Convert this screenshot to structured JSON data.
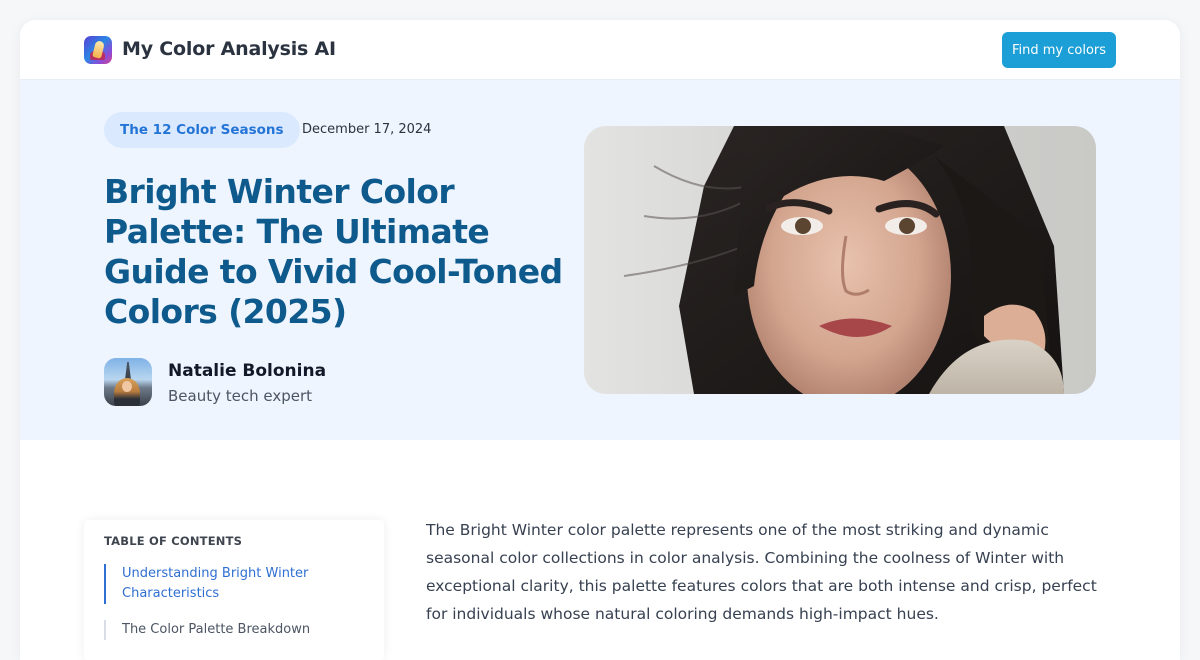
{
  "header": {
    "brand": "My Color Analysis AI",
    "cta_label": "Find my colors"
  },
  "hero": {
    "category": "The 12 Color Seasons",
    "date": "December 17, 2024",
    "title": "Bright Winter Color Palette: The Ultimate Guide to Vivid Cool-Toned Colors (2025)",
    "author": {
      "name": "Natalie Bolonina",
      "role": "Beauty tech expert"
    }
  },
  "toc": {
    "heading": "TABLE OF CONTENTS",
    "items": [
      {
        "label": "Understanding Bright Winter Characteristics",
        "active": true
      },
      {
        "label": "The Color Palette Breakdown",
        "active": false
      }
    ]
  },
  "article": {
    "intro": "The Bright Winter color palette represents one of the most striking and dynamic seasonal color collections in color analysis. Combining the coolness of Winter with exceptional clarity, this palette features colors that are both intense and crisp, perfect for individuals whose natural coloring demands high-impact hues."
  },
  "colors": {
    "accent": "#1b9fd6",
    "title": "#0f5a8c",
    "hero_bg": "#eef5ff",
    "tag_bg": "#dbe9ff",
    "link": "#2f6fd1"
  }
}
